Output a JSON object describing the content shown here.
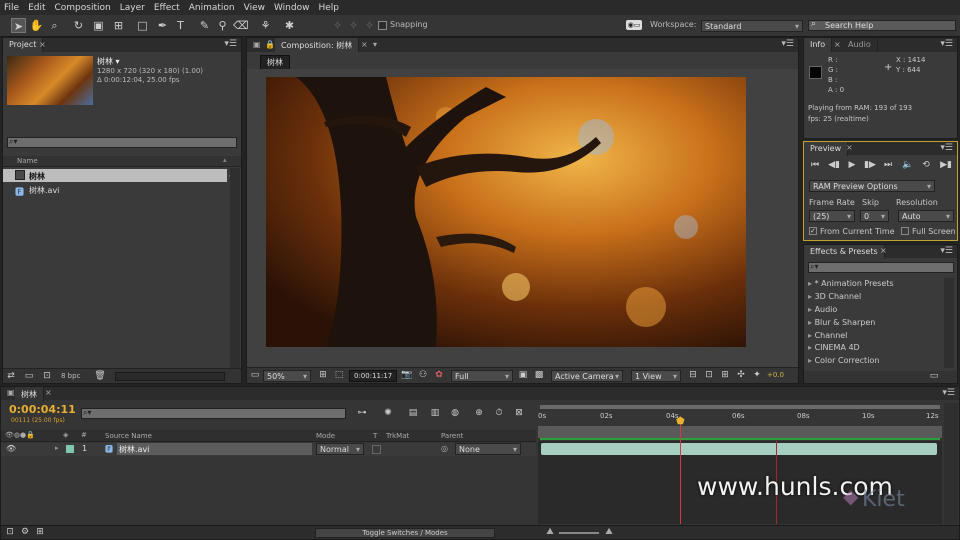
{
  "menus": [
    "File",
    "Edit",
    "Composition",
    "Layer",
    "Effect",
    "Animation",
    "View",
    "Window",
    "Help"
  ],
  "toolbar": {
    "snapping": "Snapping",
    "workspace_label": "Workspace:",
    "workspace_value": "Standard",
    "search_placeholder": "Search Help"
  },
  "project": {
    "tab": "Project",
    "comp_name": "树林 ▾",
    "comp_res": "1280 x 720  (320 x 180) (1.00)",
    "comp_dur": "Δ 0:00:12:04, 25.00 fps",
    "col_name": "Name",
    "items": [
      "树林",
      "树林.avi"
    ],
    "bpc": "8 bpc"
  },
  "composition": {
    "tab": "Composition: 树林",
    "breadcrumb": "树林",
    "zoom": "50%",
    "time": "0:00:11:17",
    "resolution": "Full",
    "camera": "Active Camera",
    "views": "1 View",
    "exposure": "+0.0"
  },
  "info": {
    "tab_info": "Info",
    "tab_audio": "Audio",
    "r": "R :",
    "g": "G :",
    "b": "B :",
    "a": "A : 0",
    "x": "X : 1414",
    "y": "Y : 644",
    "playing": "Playing from RAM: 193 of 193",
    "fps": "fps: 25 (realtime)"
  },
  "preview": {
    "tab": "Preview",
    "ram_options": "RAM Preview Options",
    "frame_rate_label": "Frame Rate",
    "frame_rate": "(25)",
    "skip_label": "Skip",
    "skip": "0",
    "resolution_label": "Resolution",
    "resolution": "Auto",
    "from_current": "From Current Time",
    "full_screen": "Full Screen"
  },
  "effects": {
    "tab": "Effects & Presets",
    "items": [
      "* Animation Presets",
      "3D Channel",
      "Audio",
      "Blur & Sharpen",
      "Channel",
      "CINEMA 4D",
      "Color Correction"
    ]
  },
  "timeline": {
    "tab": "树林",
    "timecode": "0:00:04:11",
    "frames": "00111 (25.00 fps)",
    "col_source": "Source Name",
    "col_mode": "Mode",
    "col_t": "T",
    "col_trkmat": "TrkMat",
    "col_parent": "Parent",
    "layer_num": "1",
    "layer_name": "树林.avi",
    "layer_mode": "Normal",
    "layer_parent": "None",
    "toggle": "Toggle Switches / Modes",
    "ruler": [
      "0s",
      "02s",
      "04s",
      "06s",
      "08s",
      "10s",
      "12s"
    ],
    "playhead_fraction": 0.35
  },
  "watermark": {
    "site": "www.hunls.com",
    "logo": "Kiet"
  }
}
